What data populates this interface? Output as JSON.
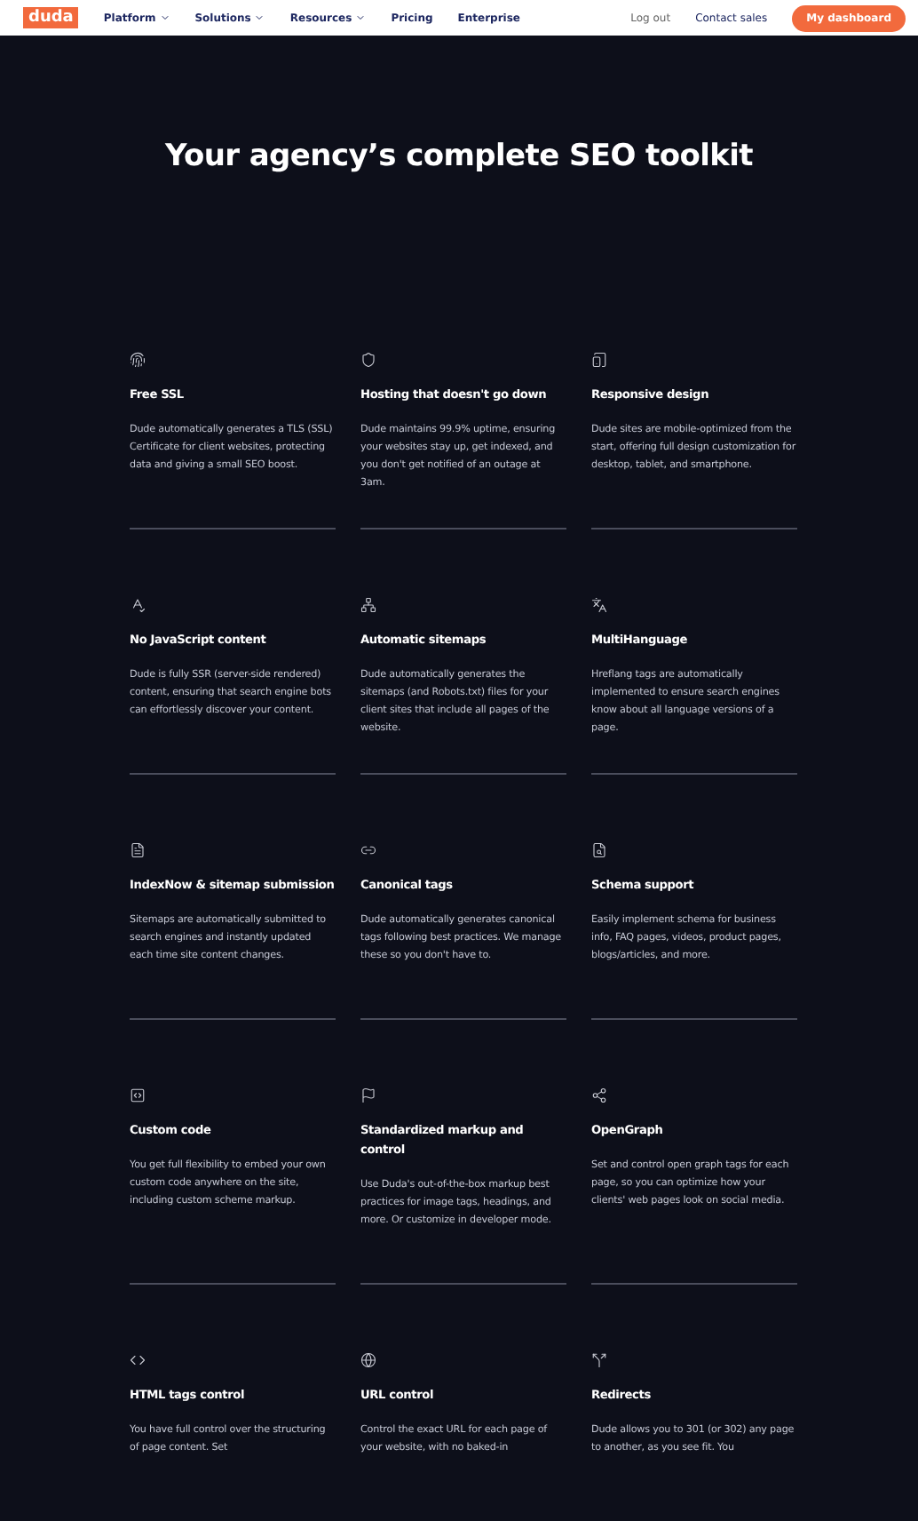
{
  "nav": {
    "logo": "duda",
    "links": [
      {
        "label": "Platform",
        "has_menu": true
      },
      {
        "label": "Solutions",
        "has_menu": true
      },
      {
        "label": "Resources",
        "has_menu": true
      },
      {
        "label": "Pricing",
        "has_menu": false
      },
      {
        "label": "Enterprise",
        "has_menu": false
      }
    ],
    "log_out": "Log out",
    "contact": "Contact sales",
    "dashboard_button": "My dashboard"
  },
  "heading": "Your agency’s complete SEO toolkit",
  "features": [
    {
      "title": "Free SSL",
      "description": "Dude automatically generates a TLS (SSL) Certificate for client websites, protecting data and giving a small SEO boost."
    },
    {
      "title": "Hosting that doesn't go down",
      "description": "Dude maintains 99.9% uptime, ensuring your websites stay up, get indexed, and you don't get notified of an outage at 3am."
    },
    {
      "title": "Responsive design",
      "description": "Dude sites are mobile-optimized from the start, offering full design customization for desktop, tablet, and smartphone."
    },
    {
      "title": "No JavaScript content",
      "description": "Dude is fully SSR (server-side rendered) content, ensuring that search engine bots can effortlessly discover your content."
    },
    {
      "title": "Automatic sitemaps",
      "description": "Dude automatically generates the sitemaps (and Robots.txt) files for your client sites that include all pages of the website."
    },
    {
      "title": "MultiHanguage",
      "description": "Hreflang tags are automatically implemented to ensure search engines know about all language versions of a page."
    },
    {
      "title": "IndexNow & sitemap submission",
      "description": "Sitemaps are automatically submitted to search engines and instantly updated each time site content changes."
    },
    {
      "title": "Canonical tags",
      "description": "Dude automatically generates canonical tags following best practices. We manage these so you don't have to."
    },
    {
      "title": "Schema support",
      "description": "Easily implement schema for business info, FAQ pages, videos, product pages, blogs/articles, and more."
    },
    {
      "title": "Custom code",
      "description": "You get full flexibility to embed your own custom code anywhere on the site, including custom scheme markup."
    },
    {
      "title": "Standardized markup and control",
      "description": "Use Duda's out-of-the-box markup best practices for image tags, headings, and more. Or customize in developer mode."
    },
    {
      "title": "OpenGraph",
      "description": "Set and control open graph tags for each page, so you can optimize how your clients' web pages look on social media."
    },
    {
      "title": "HTML tags control",
      "description": "You have full control over the structuring of page content. Set"
    },
    {
      "title": "URL control",
      "description": "Control the exact URL for each page of your website, with no baked-in"
    },
    {
      "title": "Redirects",
      "description": "Dude allows you to 301 (or 302) any page to another, as you see fit. You"
    }
  ]
}
